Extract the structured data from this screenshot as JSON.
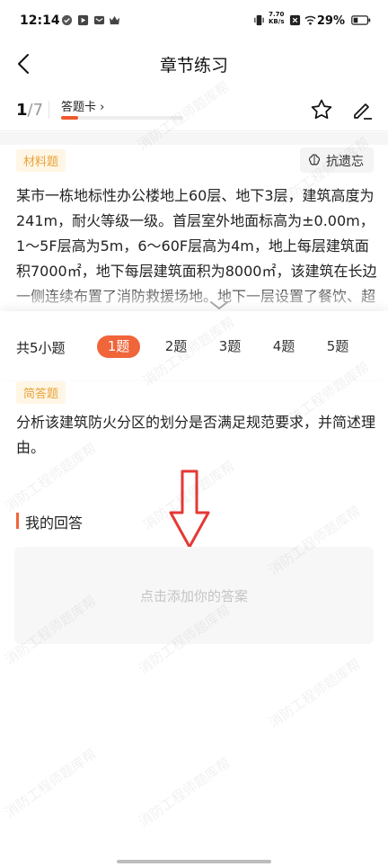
{
  "status_bar": {
    "time": "12:14",
    "net_speed_value": "7.70",
    "net_speed_unit": "KB/s",
    "battery": "29%"
  },
  "header": {
    "title": "章节练习"
  },
  "toolbar": {
    "progress_current": "1",
    "progress_total": "/7",
    "answer_card_label": "答题卡 ›",
    "answer_card_progress": 0.14
  },
  "material": {
    "tag": "材料题",
    "memory_label": "抗遗忘",
    "text": "某市一栋地标性办公楼地上60层、地下3层，建筑高度为241m，耐火等级一级。首层室外地面标高为±0.00m，1～5F层高为5m，6～60F层高为4m，地上每层建筑面积7000㎡，地下每层建筑面积为8000㎡，该建筑在长边一侧连续布置了消防救援场地。地下一层设置了餐饮、超市和设备用房，地下二、三层为汽车库和设备用房。"
  },
  "questions": {
    "total_label": "共5小题",
    "tabs": [
      "1题",
      "2题",
      "3题",
      "4题",
      "5题"
    ],
    "active_index": 0
  },
  "question": {
    "tag": "简答题",
    "text": "分析该建筑防火分区的划分是否满足规范要求，并简述理由。"
  },
  "answer": {
    "title": "我的回答",
    "placeholder": "点击添加你的答案"
  },
  "watermark_text": "消防工程师题库帮",
  "colors": {
    "accent": "#f0653a",
    "tag_bg": "#fff6e5",
    "tag_text": "#e8a33a",
    "arrow": "#e53935"
  }
}
